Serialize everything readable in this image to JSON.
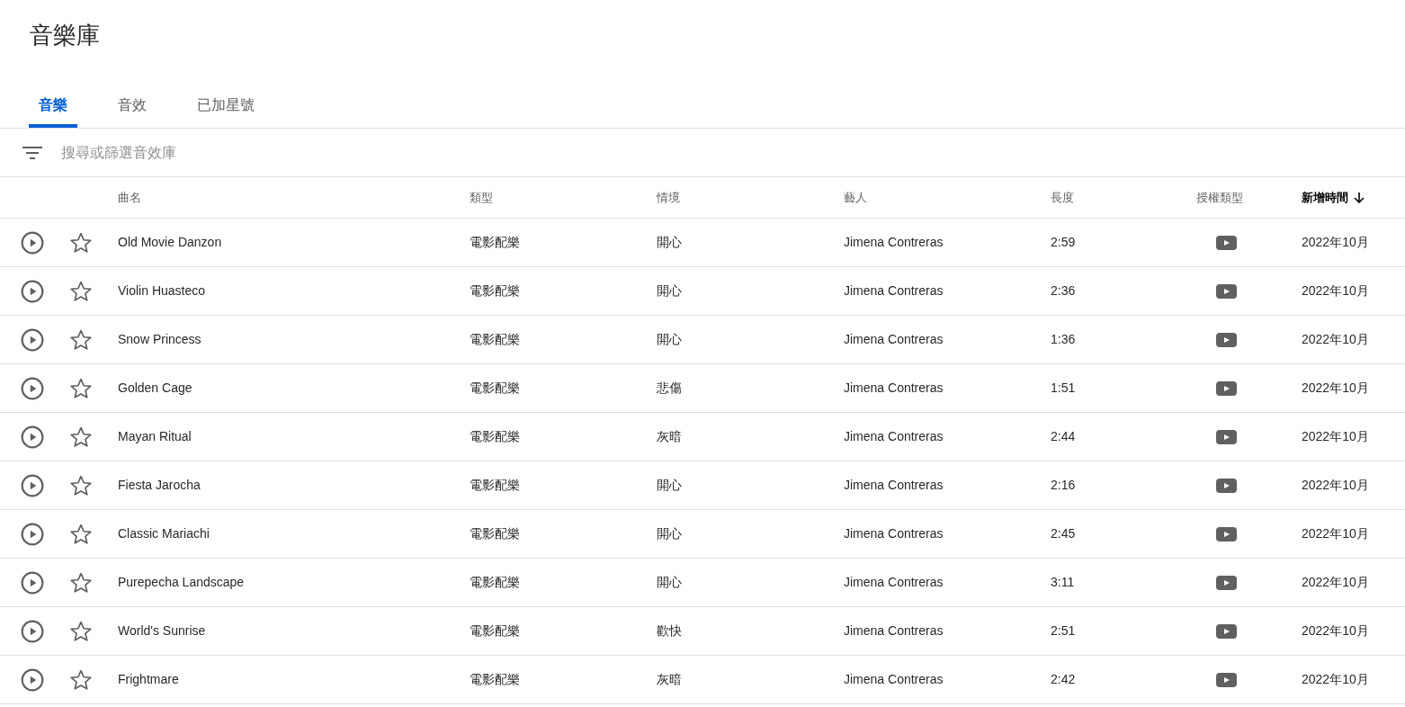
{
  "page_title": "音樂庫",
  "tabs": [
    {
      "label": "音樂",
      "selected": true
    },
    {
      "label": "音效",
      "selected": false
    },
    {
      "label": "已加星號",
      "selected": false
    }
  ],
  "search": {
    "placeholder": "搜尋或篩選音效庫"
  },
  "table": {
    "columns": [
      {
        "label": "曲名",
        "sorted": false
      },
      {
        "label": "類型",
        "sorted": false
      },
      {
        "label": "情境",
        "sorted": false
      },
      {
        "label": "藝人",
        "sorted": false
      },
      {
        "label": "長度",
        "sorted": false
      },
      {
        "label": "授權類型",
        "sorted": false
      },
      {
        "label": "新增時間",
        "sorted": true
      }
    ],
    "rows": [
      {
        "starred": false,
        "title": "Old Movie Danzon",
        "genre": "電影配樂",
        "mood": "開心",
        "artist": "Jimena Contreras",
        "length": "2:59",
        "license": {
          "kind": "video"
        },
        "added": "2022年10月"
      },
      {
        "starred": false,
        "title": "Violin Huasteco",
        "genre": "電影配樂",
        "mood": "開心",
        "artist": "Jimena Contreras",
        "length": "2:36",
        "license": {
          "kind": "video"
        },
        "added": "2022年10月"
      },
      {
        "starred": false,
        "title": "Snow Princess",
        "genre": "電影配樂",
        "mood": "開心",
        "artist": "Jimena Contreras",
        "length": "1:36",
        "license": {
          "kind": "video"
        },
        "added": "2022年10月"
      },
      {
        "starred": false,
        "title": "Golden Cage",
        "genre": "電影配樂",
        "mood": "悲傷",
        "artist": "Jimena Contreras",
        "length": "1:51",
        "license": {
          "kind": "video"
        },
        "added": "2022年10月"
      },
      {
        "starred": false,
        "title": "Mayan Ritual",
        "genre": "電影配樂",
        "mood": "灰暗",
        "artist": "Jimena Contreras",
        "length": "2:44",
        "license": {
          "kind": "video"
        },
        "added": "2022年10月"
      },
      {
        "starred": false,
        "title": "Fiesta Jarocha",
        "genre": "電影配樂",
        "mood": "開心",
        "artist": "Jimena Contreras",
        "length": "2:16",
        "license": {
          "kind": "video"
        },
        "added": "2022年10月"
      },
      {
        "starred": false,
        "title": "Classic Mariachi",
        "genre": "電影配樂",
        "mood": "開心",
        "artist": "Jimena Contreras",
        "length": "2:45",
        "license": {
          "kind": "video"
        },
        "added": "2022年10月"
      },
      {
        "starred": false,
        "title": "Purepecha Landscape",
        "genre": "電影配樂",
        "mood": "開心",
        "artist": "Jimena Contreras",
        "length": "3:11",
        "license": {
          "kind": "video"
        },
        "added": "2022年10月"
      },
      {
        "starred": false,
        "title": "World's Sunrise",
        "genre": "電影配樂",
        "mood": "歡快",
        "artist": "Jimena Contreras",
        "length": "2:51",
        "license": {
          "kind": "video"
        },
        "added": "2022年10月"
      },
      {
        "starred": false,
        "title": "Frightmare",
        "genre": "電影配樂",
        "mood": "灰暗",
        "artist": "Jimena Contreras",
        "length": "2:42",
        "license": {
          "kind": "video"
        },
        "added": "2022年10月"
      }
    ]
  }
}
